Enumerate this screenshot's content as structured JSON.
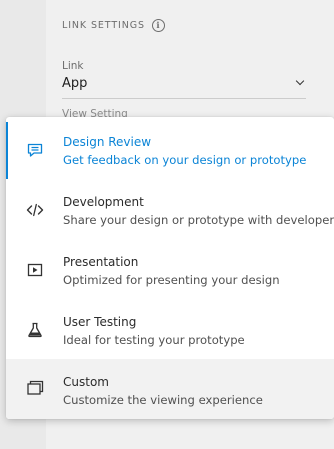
{
  "panel": {
    "section_title": "LINK SETTINGS",
    "info_icon": "info-icon",
    "link_label": "Link",
    "link_value": "App",
    "peek_label": "View Setting"
  },
  "menu": {
    "items": [
      {
        "title": "Design Review",
        "description": "Get feedback on your design or prototype",
        "icon": "comment-icon",
        "selected": true
      },
      {
        "title": "Development",
        "description": "Share your design or prototype with developers",
        "icon": "code-icon"
      },
      {
        "title": "Presentation",
        "description": "Optimized for presenting your design",
        "icon": "play-icon"
      },
      {
        "title": "User Testing",
        "description": "Ideal for testing your prototype",
        "icon": "flask-icon"
      },
      {
        "title": "Custom",
        "description": "Customize the viewing experience",
        "icon": "windows-icon",
        "hovered": true
      }
    ]
  },
  "colors": {
    "accent": "#0b84d6",
    "panel_bg": "#f0f0f0",
    "menu_bg": "#ffffff"
  }
}
